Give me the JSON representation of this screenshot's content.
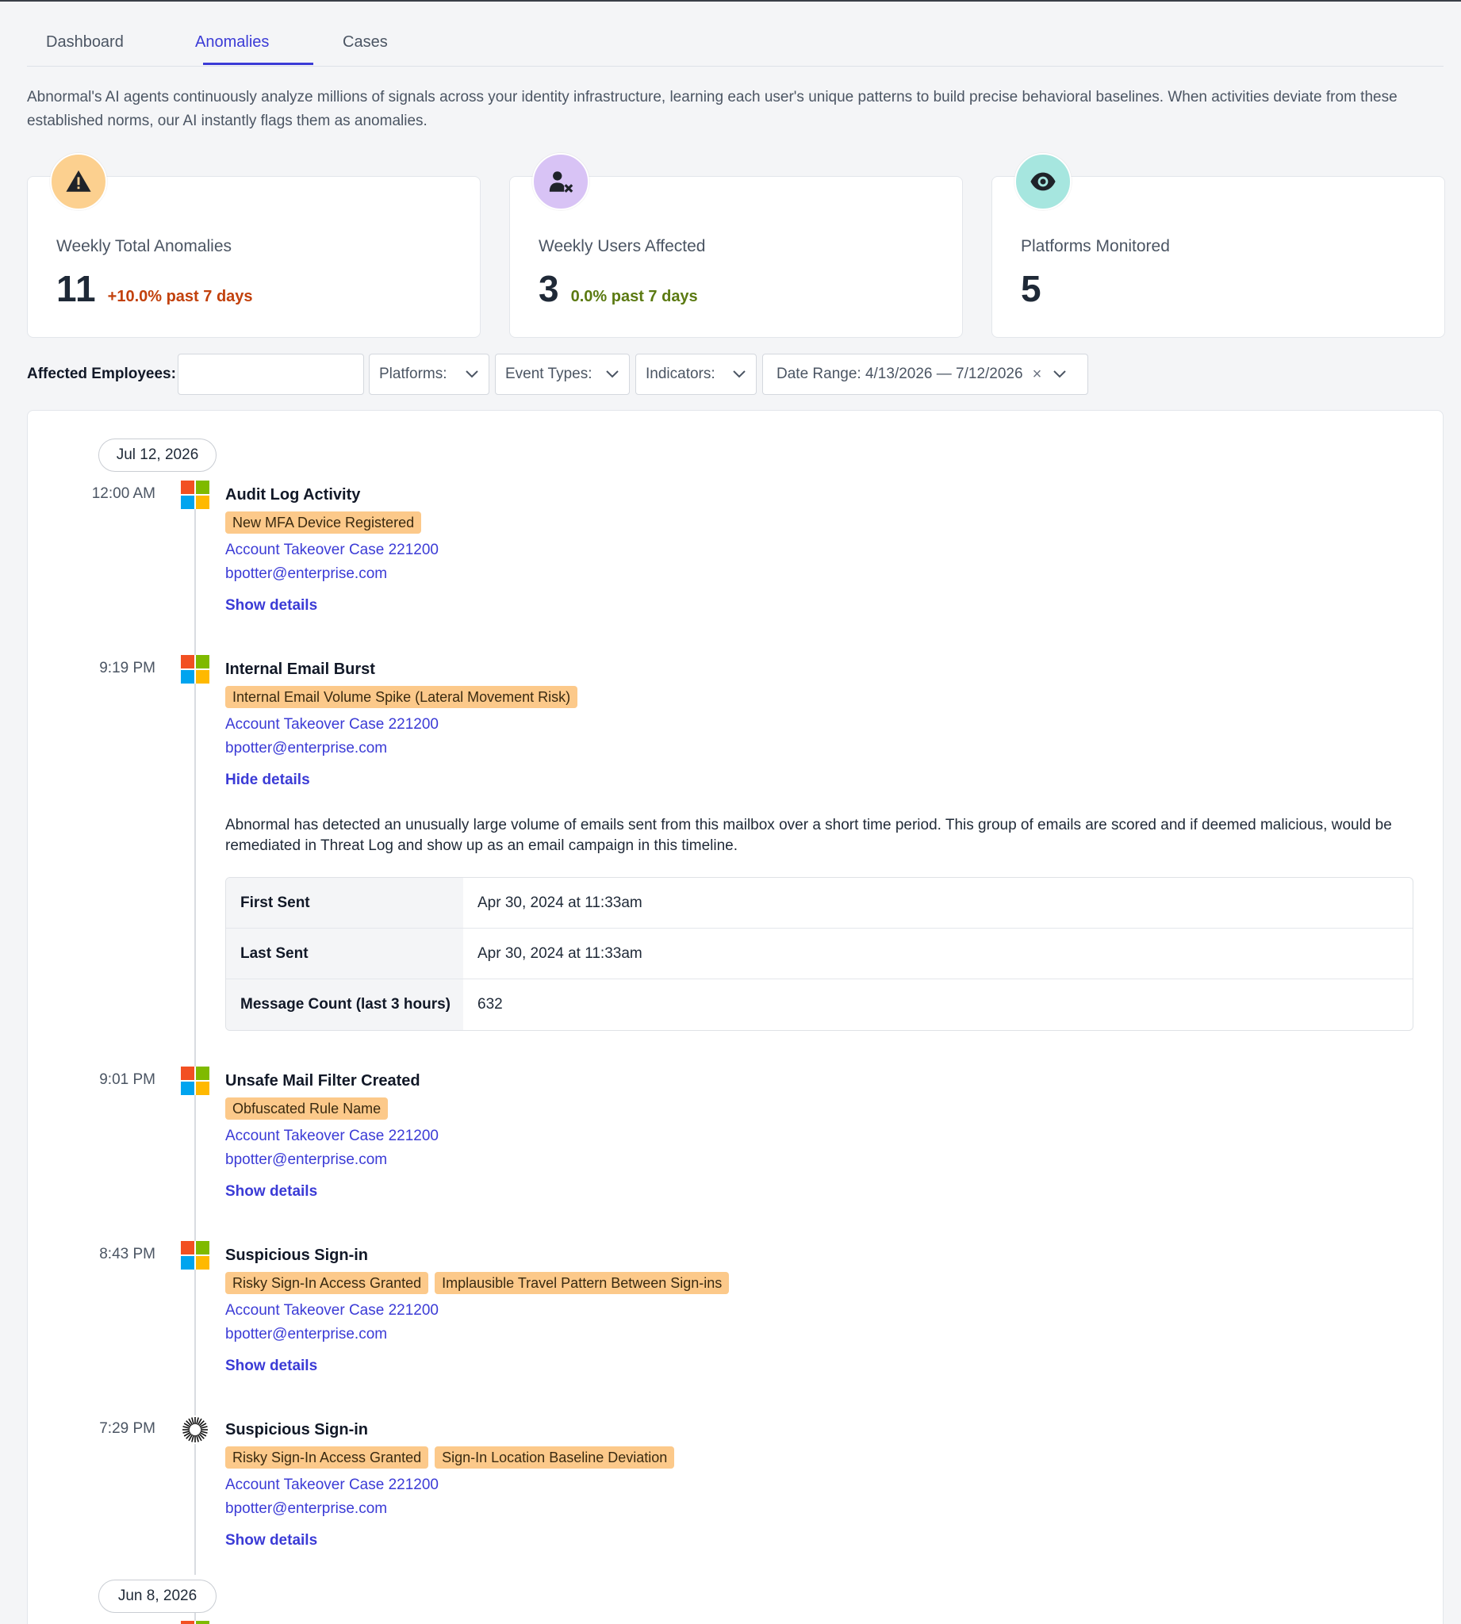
{
  "tabs": [
    {
      "label": "Dashboard"
    },
    {
      "label": "Anomalies"
    },
    {
      "label": "Cases"
    }
  ],
  "active_tab": "Anomalies",
  "intro": "Abnormal's AI agents continuously analyze millions of signals across your identity infrastructure, learning each user's unique patterns to build precise behavioral baselines. When activities deviate from these established norms, our AI instantly flags them as anomalies.",
  "stats": [
    {
      "icon": "warning-icon",
      "icon_bg": "#fcd08f",
      "label": "Weekly Total Anomalies",
      "value": "11",
      "delta": "+10.0% past 7 days",
      "delta_color": "#c2410c"
    },
    {
      "icon": "user-x-icon",
      "icon_bg": "#d8c3f5",
      "label": "Weekly Users Affected",
      "value": "3",
      "delta": "0.0% past 7 days",
      "delta_color": "#5b7a12"
    },
    {
      "icon": "eye-icon",
      "icon_bg": "#a6e6df",
      "label": "Platforms Monitored",
      "value": "5",
      "delta": ""
    }
  ],
  "filters": {
    "employees_label": "Affected Employees:",
    "employees_value": "",
    "platforms": "Platforms:",
    "event_types": "Event Types:",
    "indicators": "Indicators:",
    "date_range": "Date Range: 4/13/2026 — 7/12/2026",
    "clear": "×"
  },
  "dates": [
    "Jul 12, 2026",
    "Jun 8, 2026"
  ],
  "events": [
    {
      "time": "12:00 AM",
      "platform": "microsoft-icon",
      "title": "Audit Log Activity",
      "badges": [
        "New MFA Device Registered"
      ],
      "case": "Account Takeover Case 221200",
      "email": "bpotter@enterprise.com",
      "toggle": "Show details"
    },
    {
      "time": "9:19 PM",
      "platform": "microsoft-icon",
      "title": "Internal Email Burst",
      "badges": [
        "Internal Email Volume Spike (Lateral Movement Risk)"
      ],
      "case": "Account Takeover Case 221200",
      "email": "bpotter@enterprise.com",
      "toggle": "Hide details"
    },
    {
      "time": "9:01 PM",
      "platform": "microsoft-icon",
      "title": "Unsafe Mail Filter Created",
      "badges": [
        "Obfuscated Rule Name"
      ],
      "case": "Account Takeover Case 221200",
      "email": "bpotter@enterprise.com",
      "toggle": "Show details"
    },
    {
      "time": "8:43 PM",
      "platform": "microsoft-icon",
      "title": "Suspicious Sign-in",
      "badges": [
        "Risky Sign-In Access Granted",
        "Implausible Travel Pattern Between Sign-ins"
      ],
      "case": "Account Takeover Case 221200",
      "email": "bpotter@enterprise.com",
      "toggle": "Show details"
    },
    {
      "time": "7:29 PM",
      "platform": "sunburst-icon",
      "title": "Suspicious Sign-in",
      "badges": [
        "Risky Sign-In Access Granted",
        "Sign-In Location Baseline Deviation"
      ],
      "case": "Account Takeover Case 221200",
      "email": "bpotter@enterprise.com",
      "toggle": "Show details"
    }
  ],
  "details": {
    "text": "Abnormal has detected an unusually large volume of emails sent from this mailbox over a short time period. This group of emails are scored and if deemed malicious, would be remediated in Threat Log and show up as an email campaign in this timeline.",
    "rows": [
      {
        "key": "First Sent",
        "value": "Apr 30, 2024 at 11:33am"
      },
      {
        "key": "Last Sent",
        "value": "Apr 30, 2024 at 11:33am"
      },
      {
        "key": "Message Count (last 3 hours)",
        "value": "632"
      }
    ]
  },
  "colors": {
    "accent": "#3b3bd6",
    "badge": "#fcc98a"
  }
}
